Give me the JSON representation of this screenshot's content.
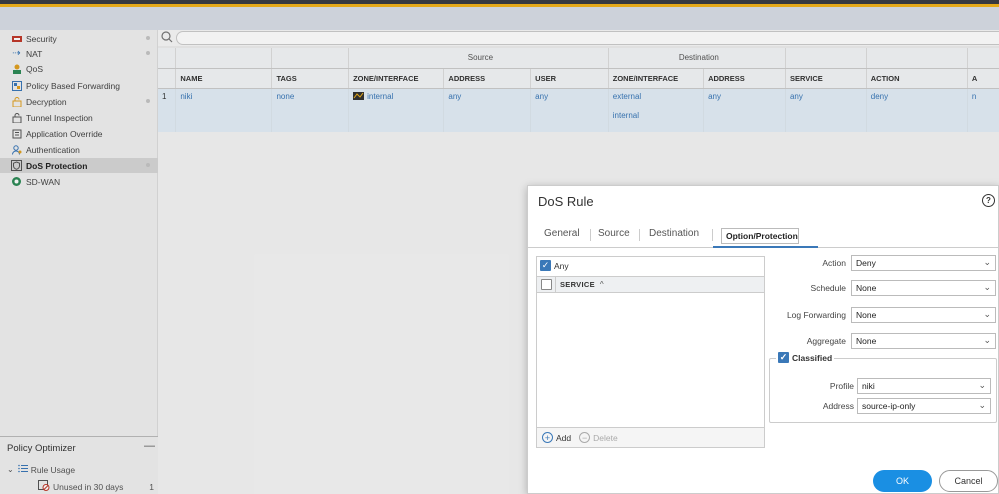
{
  "colors": {
    "accent": "#3a78b8",
    "primary_button": "#1a8fe3",
    "top_accent": "#f2b31b",
    "row_highlight": "#e3eef7"
  },
  "sidebar": {
    "items": [
      {
        "label": "Security",
        "icon": "security-icon",
        "dot": true
      },
      {
        "label": "NAT",
        "icon": "nat-icon",
        "dot": true
      },
      {
        "label": "QoS",
        "icon": "qos-icon",
        "dot": false
      },
      {
        "label": "Policy Based Forwarding",
        "icon": "pbf-icon",
        "dot": false
      },
      {
        "label": "Decryption",
        "icon": "decryption-icon",
        "dot": true
      },
      {
        "label": "Tunnel Inspection",
        "icon": "tunnel-icon",
        "dot": false
      },
      {
        "label": "Application Override",
        "icon": "app-override-icon",
        "dot": false
      },
      {
        "label": "Authentication",
        "icon": "authentication-icon",
        "dot": false
      },
      {
        "label": "DoS Protection",
        "icon": "dos-icon",
        "dot": true,
        "active": true
      },
      {
        "label": "SD-WAN",
        "icon": "sdwan-icon",
        "dot": false
      }
    ]
  },
  "optimizer": {
    "title": "Policy Optimizer",
    "min_label": "—",
    "rule_usage": "Rule Usage",
    "unused_label": "Unused in 30 days",
    "unused_count": "1"
  },
  "table": {
    "groups": {
      "source": "Source",
      "destination": "Destination"
    },
    "headers": {
      "name": "NAME",
      "tags": "TAGS",
      "src_zone": "ZONE/INTERFACE",
      "src_address": "ADDRESS",
      "src_user": "USER",
      "dst_zone": "ZONE/INTERFACE",
      "dst_address": "ADDRESS",
      "service": "SERVICE",
      "action": "ACTION",
      "extra": "A"
    },
    "rows": [
      {
        "index": "1",
        "name": "niki",
        "tags": "none",
        "src_zone": "internal",
        "src_address": "any",
        "src_user": "any",
        "dst_zone_1": "external",
        "dst_zone_2": "internal",
        "dst_address": "any",
        "service": "any",
        "action": "deny",
        "extra": "n"
      }
    ]
  },
  "dialog": {
    "title": "DoS Rule",
    "help": "?",
    "tabs": [
      "General",
      "Source",
      "Destination",
      "Option/Protection"
    ],
    "selected_tab": "Option/Protection",
    "service": {
      "any_label": "Any",
      "any_checked": true,
      "column": "SERVICE",
      "sort_icon": "^",
      "add": "Add",
      "delete": "Delete"
    },
    "fields": {
      "action": {
        "label": "Action",
        "value": "Deny"
      },
      "schedule": {
        "label": "Schedule",
        "value": "None"
      },
      "log_forwarding": {
        "label": "Log Forwarding",
        "value": "None"
      },
      "aggregate": {
        "label": "Aggregate",
        "value": "None"
      }
    },
    "classified": {
      "label": "Classified",
      "checked": true,
      "profile_label": "Profile",
      "profile": "niki",
      "address_label": "Address",
      "address": "source-ip-only"
    },
    "ok": "OK",
    "cancel": "Cancel"
  }
}
